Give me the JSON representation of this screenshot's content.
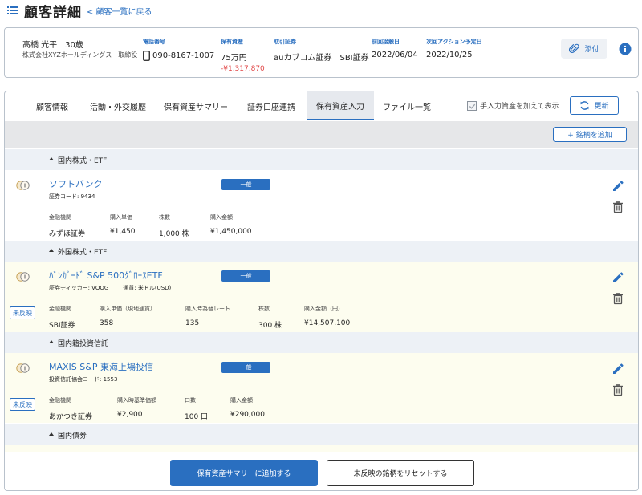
{
  "header": {
    "title": "顧客詳細",
    "back_link": "< 顧客一覧に戻る"
  },
  "customer": {
    "name": "高橋 光平　30歳",
    "company": "株式会社XYZホールディングス　取締役",
    "phone_label": "電話番号",
    "phone_value": "090-8167-1007",
    "assets_label": "保有資産",
    "assets_value": "75万円",
    "assets_change": "-¥1,317,870",
    "broker_label": "取引証券",
    "broker_value": "auカブコム証券　SBI証券",
    "last_contact_label": "前回接触日",
    "last_contact_value": "2022/06/04",
    "next_action_label": "次回アクション予定日",
    "next_action_value": "2022/10/25",
    "attach_label": "添付"
  },
  "tabs": [
    {
      "label": "顧客情報"
    },
    {
      "label": "活動・外交履歴"
    },
    {
      "label": "保有資産サマリー"
    },
    {
      "label": "証券口座連携"
    },
    {
      "label": "保有資産入力"
    },
    {
      "label": "ファイル一覧"
    }
  ],
  "active_tab": "保有資産入力",
  "toolbar": {
    "manual_checkbox_label": "手入力資産を加えて表示",
    "refresh_label": "更新",
    "add_label": "+ 銘柄を追加"
  },
  "sections": [
    {
      "title": "国内株式・ETF",
      "asset": {
        "name": "ソフトバンク",
        "code": "証券コード: 9434",
        "code2": "",
        "badge": "一般",
        "unreflected": "",
        "fields": [
          {
            "label": "金融機関",
            "value": "みずほ証券"
          },
          {
            "label": "購入単価",
            "value": "¥1,450"
          },
          {
            "label": "株数",
            "value": "1,000 株"
          },
          {
            "label": "購入金額",
            "value": "¥1,450,000"
          }
        ]
      }
    },
    {
      "title": "外国株式・ETF",
      "asset": {
        "name": "ﾊﾞﾝｶﾞｰﾄﾞ S&P 500ｸﾞﾛｰｽETF",
        "code": "証券ティッカー: VOOG",
        "code2": "通貨: 米ドル(USD)",
        "badge": "一般",
        "unreflected": "未反映",
        "fields": [
          {
            "label": "金融機関",
            "value": "SBI証券"
          },
          {
            "label": "購入単価（現地通貨）",
            "value": "358"
          },
          {
            "label": "購入時為替レート",
            "value": "135"
          },
          {
            "label": "株数",
            "value": "300 株"
          },
          {
            "label": "購入金額（円）",
            "value": "¥14,507,100"
          }
        ]
      }
    },
    {
      "title": "国内籍投資信託",
      "asset": {
        "name": "MAXIS S&P 東海上場投信",
        "code": "投資信託協会コード: 1553",
        "code2": "",
        "badge": "一般",
        "unreflected": "未反映",
        "fields": [
          {
            "label": "金融機関",
            "value": "あかつき証券"
          },
          {
            "label": "購入時基準価額",
            "value": "¥2,900"
          },
          {
            "label": "口数",
            "value": "100 口"
          },
          {
            "label": "購入金額",
            "value": "¥290,000"
          }
        ]
      }
    },
    {
      "title": "国内債券"
    }
  ],
  "footer": {
    "primary_label": "保有資産サマリーに追加する",
    "secondary_label": "未反映の銘柄をリセットする"
  },
  "colors": {
    "accent": "#2a6fc0",
    "negative": "#e04545",
    "highlight_row": "#fdfdef"
  }
}
